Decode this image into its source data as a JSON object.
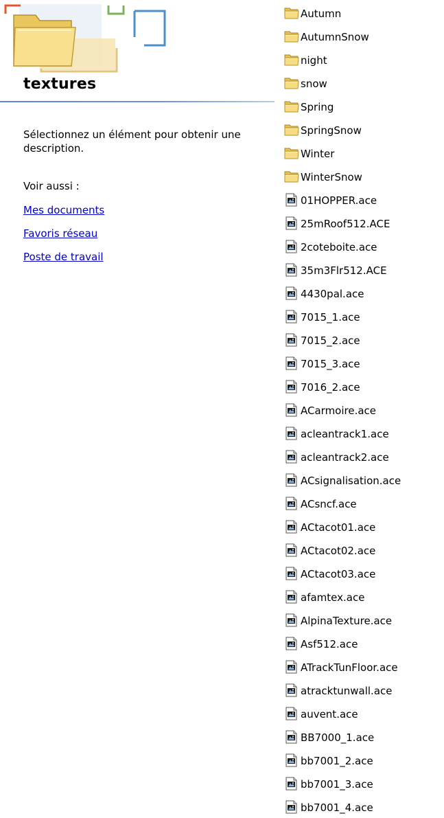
{
  "left_pane": {
    "title": "textures",
    "description": "Sélectionnez un élément pour obtenir une description.",
    "see_also_label": "Voir aussi :",
    "links": [
      "Mes documents",
      "Favoris réseau",
      "Poste de travail"
    ]
  },
  "files": [
    {
      "name": "Autumn",
      "type": "folder"
    },
    {
      "name": "AutumnSnow",
      "type": "folder"
    },
    {
      "name": "night",
      "type": "folder"
    },
    {
      "name": "snow",
      "type": "folder"
    },
    {
      "name": "Spring",
      "type": "folder"
    },
    {
      "name": "SpringSnow",
      "type": "folder"
    },
    {
      "name": "Winter",
      "type": "folder"
    },
    {
      "name": "WinterSnow",
      "type": "folder"
    },
    {
      "name": "01HOPPER.ace",
      "type": "ace"
    },
    {
      "name": "25mRoof512.ACE",
      "type": "ace"
    },
    {
      "name": "2coteboite.ace",
      "type": "ace"
    },
    {
      "name": "35m3Flr512.ACE",
      "type": "ace"
    },
    {
      "name": "4430pal.ace",
      "type": "ace"
    },
    {
      "name": "7015_1.ace",
      "type": "ace"
    },
    {
      "name": "7015_2.ace",
      "type": "ace"
    },
    {
      "name": "7015_3.ace",
      "type": "ace"
    },
    {
      "name": "7016_2.ace",
      "type": "ace"
    },
    {
      "name": "ACarmoire.ace",
      "type": "ace"
    },
    {
      "name": "acleantrack1.ace",
      "type": "ace"
    },
    {
      "name": "acleantrack2.ace",
      "type": "ace"
    },
    {
      "name": "ACsignalisation.ace",
      "type": "ace"
    },
    {
      "name": "ACsncf.ace",
      "type": "ace"
    },
    {
      "name": "ACtacot01.ace",
      "type": "ace"
    },
    {
      "name": "ACtacot02.ace",
      "type": "ace"
    },
    {
      "name": "ACtacot03.ace",
      "type": "ace"
    },
    {
      "name": "afamtex.ace",
      "type": "ace"
    },
    {
      "name": "AlpinaTexture.ace",
      "type": "ace"
    },
    {
      "name": "Asf512.ace",
      "type": "ace"
    },
    {
      "name": "ATrackTunFloor.ace",
      "type": "ace"
    },
    {
      "name": "atracktunwall.ace",
      "type": "ace"
    },
    {
      "name": "auvent.ace",
      "type": "ace"
    },
    {
      "name": "BB7000_1.ace",
      "type": "ace"
    },
    {
      "name": "bb7001_2.ace",
      "type": "ace"
    },
    {
      "name": "bb7001_3.ace",
      "type": "ace"
    },
    {
      "name": "bb7001_4.ace",
      "type": "ace"
    }
  ],
  "icons": {
    "folder": "folder-icon",
    "ace": "ace-file-icon"
  },
  "colors": {
    "link": "#0000cc",
    "title_rule": "#5a87c8",
    "folder_fill": "#f2d67a"
  }
}
